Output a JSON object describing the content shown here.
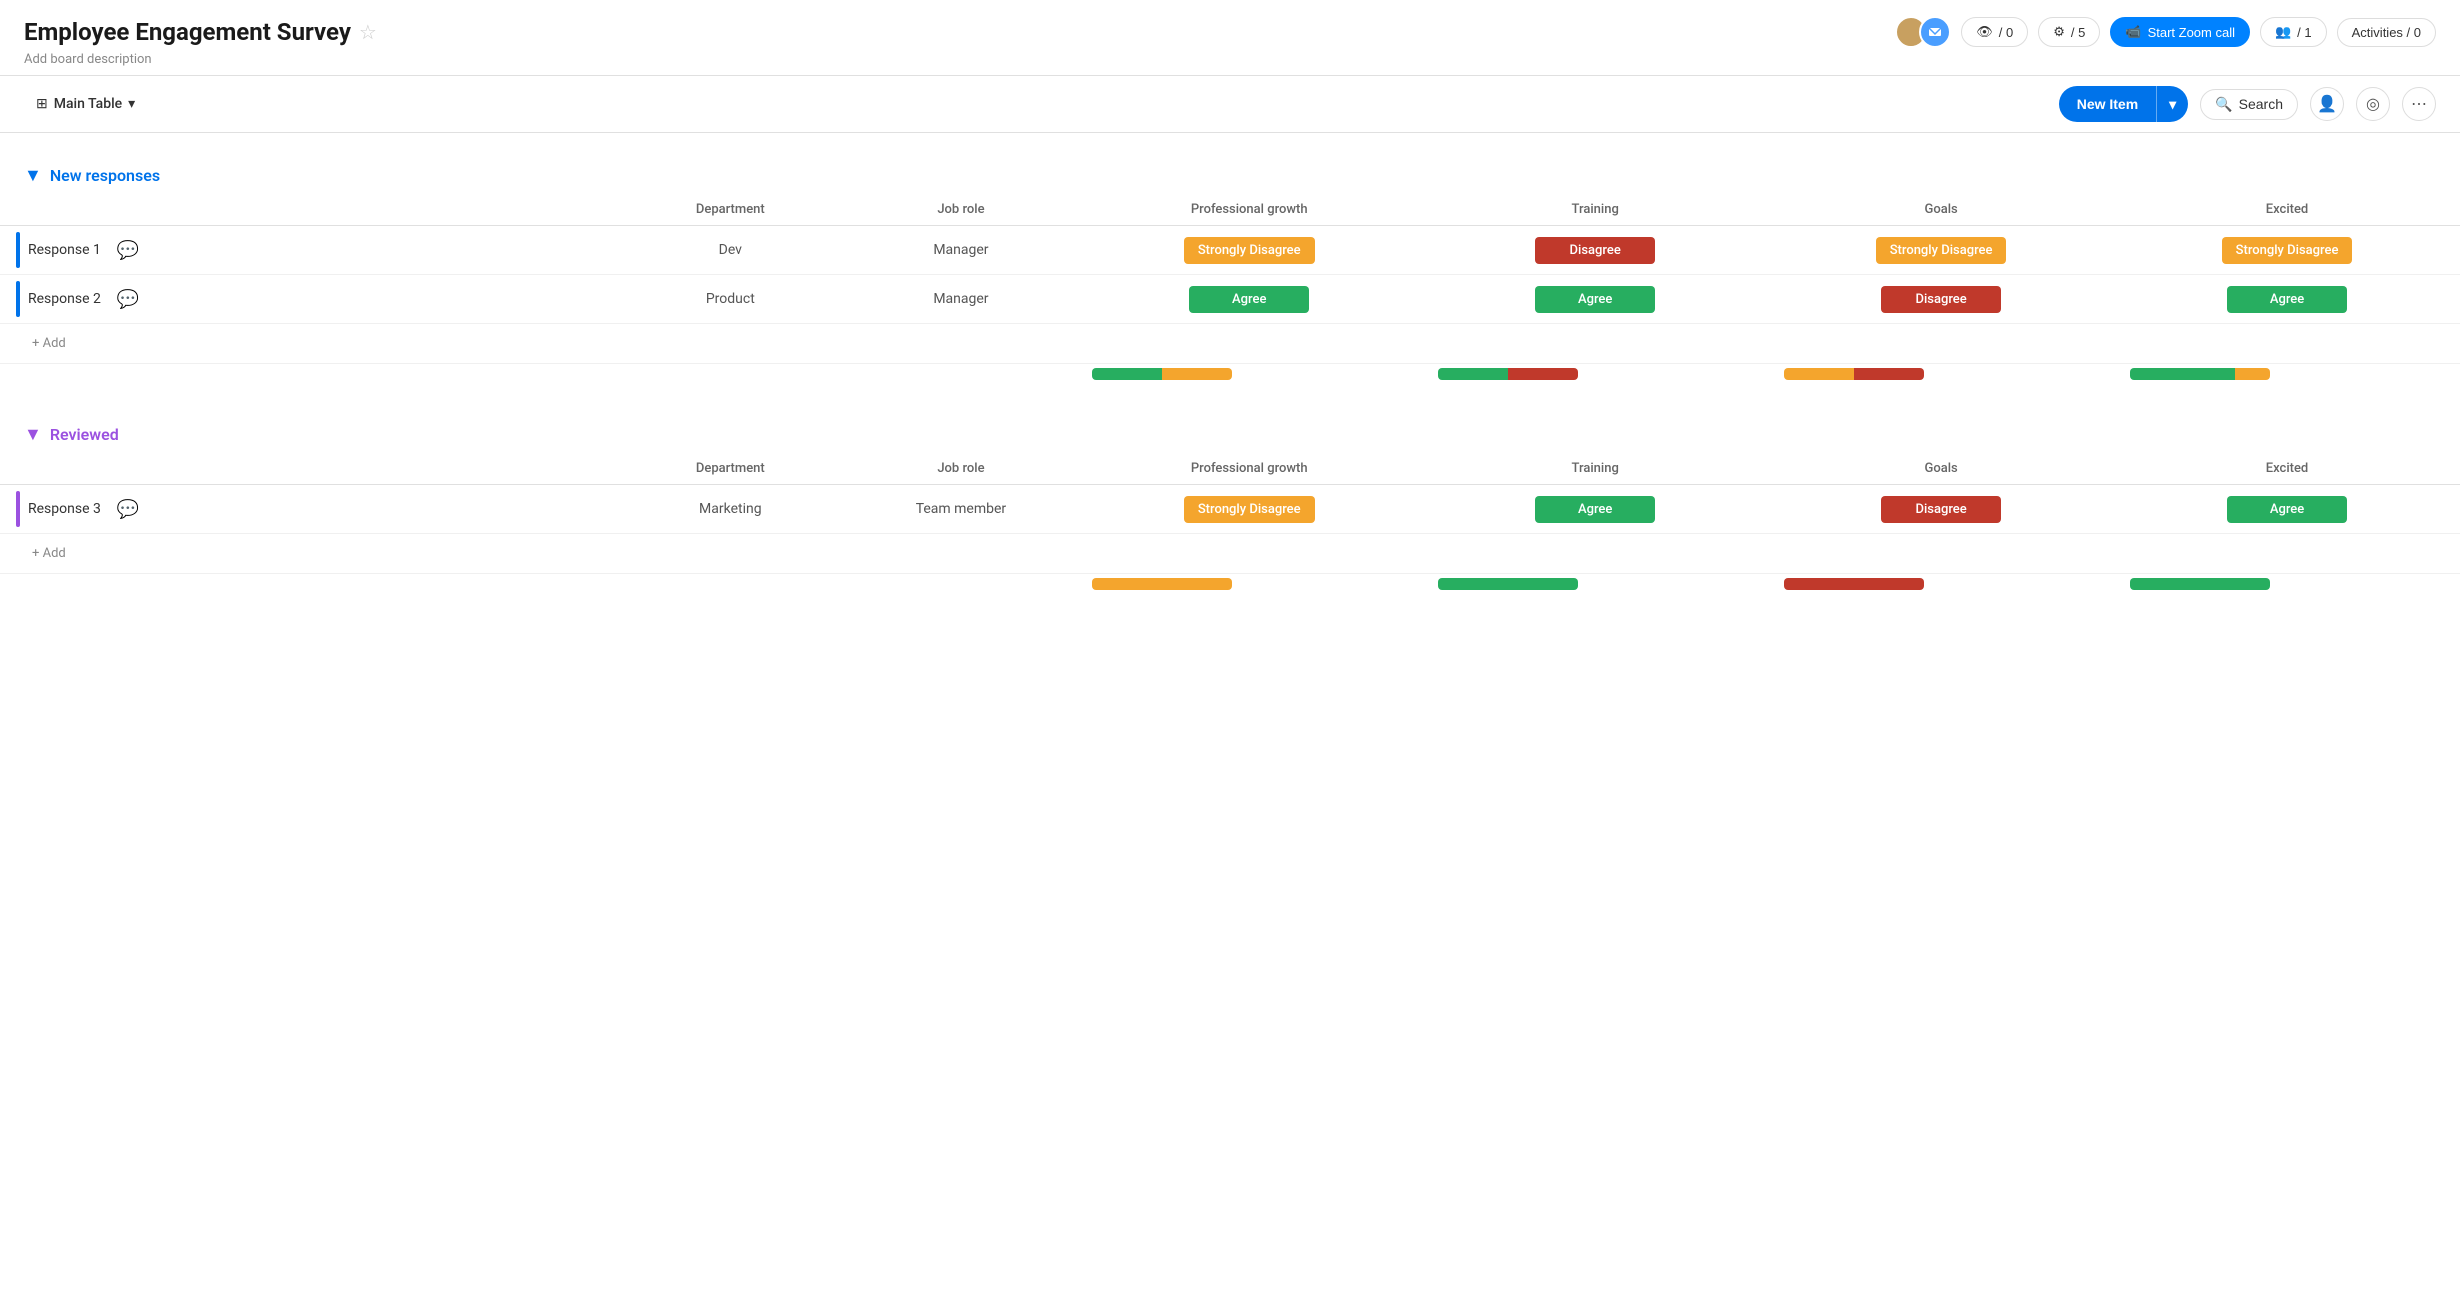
{
  "header": {
    "title": "Employee Engagement Survey",
    "star_label": "★",
    "description": "Add board description",
    "actions": {
      "views_count": "/ 0",
      "automations_count": "/ 5",
      "zoom_label": "Start Zoom call",
      "members_count": "/ 1",
      "activities_label": "Activities / 0"
    }
  },
  "toolbar": {
    "table_name": "Main Table",
    "new_item_label": "New Item",
    "search_label": "Search"
  },
  "groups": [
    {
      "id": "new-responses",
      "title": "New responses",
      "color": "new",
      "columns": [
        "Department",
        "Job role",
        "Professional growth",
        "Training",
        "Goals",
        "Excited"
      ],
      "rows": [
        {
          "id": 1,
          "name": "Response 1",
          "department": "Dev",
          "job_role": "Manager",
          "professional_growth": "Strongly Disagree",
          "professional_growth_color": "orange",
          "training": "Disagree",
          "training_color": "red",
          "goals": "Strongly Disagree",
          "goals_color": "orange",
          "excited": "Strongly Disagree",
          "excited_color": "orange"
        },
        {
          "id": 2,
          "name": "Response 2",
          "department": "Product",
          "job_role": "Manager",
          "professional_growth": "Agree",
          "professional_growth_color": "green",
          "training": "Agree",
          "training_color": "green",
          "goals": "Disagree",
          "goals_color": "red",
          "excited": "Agree",
          "excited_color": "green"
        }
      ],
      "summary_bars": [
        {
          "green": 50,
          "orange": 50,
          "red": 0
        },
        {
          "green": 50,
          "orange": 0,
          "red": 50
        },
        {
          "green": 0,
          "orange": 50,
          "red": 50
        },
        {
          "green": 75,
          "orange": 25,
          "red": 0
        }
      ],
      "add_label": "+ Add"
    },
    {
      "id": "reviewed",
      "title": "Reviewed",
      "color": "reviewed",
      "columns": [
        "Department",
        "Job role",
        "Professional growth",
        "Training",
        "Goals",
        "Excited"
      ],
      "rows": [
        {
          "id": 3,
          "name": "Response 3",
          "department": "Marketing",
          "job_role": "Team member",
          "professional_growth": "Strongly Disagree",
          "professional_growth_color": "orange",
          "training": "Agree",
          "training_color": "green",
          "goals": "Disagree",
          "goals_color": "red",
          "excited": "Agree",
          "excited_color": "green"
        }
      ],
      "summary_bars": [
        {
          "green": 0,
          "orange": 100,
          "red": 0
        },
        {
          "green": 100,
          "orange": 0,
          "red": 0
        },
        {
          "green": 0,
          "orange": 0,
          "red": 100
        },
        {
          "green": 100,
          "orange": 0,
          "red": 0
        }
      ],
      "add_label": "+ Add"
    }
  ]
}
